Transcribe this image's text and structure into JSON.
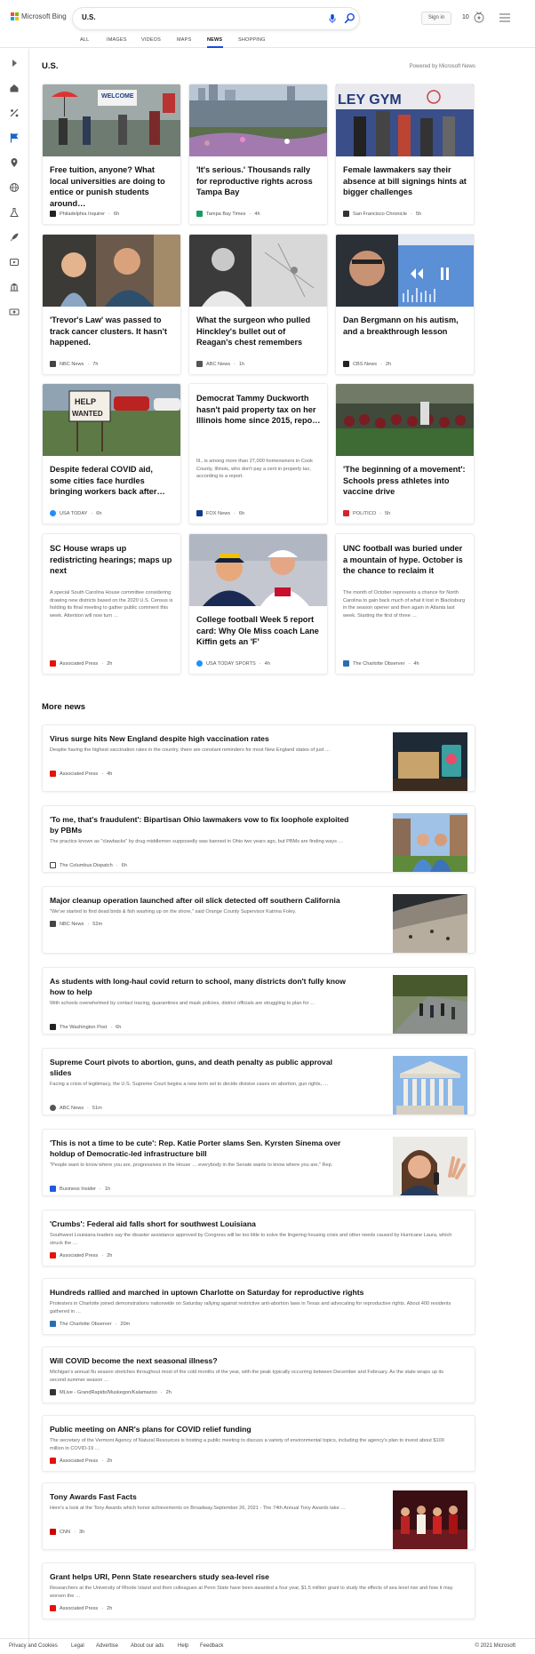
{
  "header": {
    "brand": "Microsoft Bing",
    "query": "U.S.",
    "sign_in": "Sign in",
    "points": "10",
    "colors": {
      "ms_red": "#f25022",
      "ms_green": "#7fba00",
      "ms_blue": "#00a4ef",
      "ms_yellow": "#ffb900",
      "accent": "#174ae4"
    }
  },
  "tabs": [
    "ALL",
    "IMAGES",
    "VIDEOS",
    "MAPS",
    "NEWS",
    "SHOPPING"
  ],
  "active_tab": "NEWS",
  "rail_icons": [
    "expand-icon",
    "home-icon",
    "sports-icon",
    "flag-icon",
    "location-icon",
    "globe-icon",
    "science-icon",
    "rocket-icon",
    "entertainment-icon",
    "bank-icon",
    "money-icon"
  ],
  "top": {
    "title": "U.S.",
    "powered": "Powered by Microsoft News"
  },
  "cards": [
    {
      "title": "Free tuition, anyone? What local universities are doing to entice or punish students around…",
      "source": "Philadelphia Inquirer",
      "time": "6h",
      "logo_color": "#222222"
    },
    {
      "title": "'It's serious.' Thousands rally for reproductive rights across Tampa Bay",
      "source": "Tampa Bay Times",
      "time": "4h",
      "logo_color": "#1a9a62"
    },
    {
      "title": "Female lawmakers say their absence at bill signings hints at bigger challenges",
      "source": "San Francisco Chronicle",
      "time": "5h",
      "logo_color": "#333333"
    },
    {
      "title": "'Trevor's Law' was passed to track cancer clusters. It hasn't happened.",
      "source": "NBC News",
      "time": "7h",
      "logo_color": "#444444"
    },
    {
      "title": "What the surgeon who pulled Hinckley's bullet out of Reagan's chest remembers",
      "source": "ABC News",
      "time": "1h",
      "logo_color": "#555555"
    },
    {
      "title": "Dan Bergmann on his autism, and a breakthrough lesson",
      "source": "CBS News",
      "time": "2h",
      "logo_color": "#222222"
    },
    {
      "title": "Despite federal COVID aid, some cities face hurdles bringing workers back after…",
      "source": "USA TODAY",
      "time": "6h",
      "logo_color": "#1e90ff"
    },
    {
      "title": "Democrat Tammy Duckworth hasn't paid property tax on her Illinois home since 2015, repo…",
      "desc": "Ill., is among more than 27,000 homeowners in Cook County, Illinois, who don't pay a cent in property tax, according to a report.",
      "source": "FOX News",
      "time": "6h",
      "logo_color": "#123a8c"
    },
    {
      "title": "'The beginning of a movement': Schools press athletes into vaccine drive",
      "source": "POLITICO",
      "time": "5h",
      "logo_color": "#d4242b"
    },
    {
      "title": "SC House wraps up redistricting hearings; maps up next",
      "desc": "A special South Carolina House committee considering drawing new districts based on the 2020 U.S. Census is holding its final meeting to gather public comment this week. Attention will now turn …",
      "source": "Associated Press",
      "time": "2h",
      "logo_color": "#e3120b"
    },
    {
      "title": "College football Week 5 report card: Why Ole Miss coach Lane Kiffin gets an 'F'",
      "source": "USA TODAY SPORTS",
      "time": "4h",
      "logo_color": "#1e90ff"
    },
    {
      "title": "UNC football was buried under a mountain of hype. October is the chance to reclaim it",
      "desc": "The month of October represents a chance for North Carolina to gain back much of what it lost in Blacksburg in the season opener and then again in Atlanta last week. Starting the first of three …",
      "source": "The Charlotte Observer",
      "time": "4h",
      "logo_color": "#2a6db5"
    }
  ],
  "more_news_title": "More news",
  "more": [
    {
      "title": "Virus surge hits New England despite high vaccination rates",
      "desc": "Despite having the highest vaccination rates in the country, there are constant reminders for most New England states of just …",
      "source": "Associated Press",
      "time": "4h",
      "logo_color": "#e3120b"
    },
    {
      "title": "'To me, that's fraudulent': Bipartisan Ohio lawmakers vow to fix loophole exploited by PBMs",
      "desc": "The practice known as \"clawbacks\" by drug middlemen supposedly was banned in Ohio two years ago, but PBMs are finding ways …",
      "source": "The Columbus Dispatch",
      "time": "6h",
      "logo_color": "#444444"
    },
    {
      "title": "Major cleanup operation launched after oil slick detected off southern California",
      "desc": "\"We've started to find dead birds & fish washing up on the shore,\" said Orange County Supervisor Katrina Foley.",
      "source": "NBC News",
      "time": "52m",
      "logo_color": "#444444"
    },
    {
      "title": "As students with long-haul covid return to school, many districts don't fully know how to help",
      "desc": "With schools overwhelmed by contact tracing, quarantines and mask policies, district officials are struggling to plan for …",
      "source": "The Washington Post",
      "time": "6h",
      "logo_color": "#222222"
    },
    {
      "title": "Supreme Court pivots to abortion, guns, and death penalty as public approval slides",
      "desc": "Facing a crisis of legitimacy, the U.S. Supreme Court begins a new term set to decide divisive cases on abortion, gun rights, …",
      "source": "ABC News",
      "time": "51m",
      "logo_color": "#555555"
    },
    {
      "title": "'This is not a time to be cute': Rep. Katie Porter slams Sen. Kyrsten Sinema over holdup of Democratic-led infrastructure bill",
      "desc": "\"People want to know where you are, progressives in the House … everybody in the Senate wants to know where you are,\" Rep.",
      "source": "Business Insider",
      "time": "1h",
      "logo_color": "#1e5cd8"
    },
    {
      "title": "'Crumbs': Federal aid falls short for southwest Louisiana",
      "desc": "Southwest Louisiana leaders say the disaster assistance approved by Congress will be too little to solve the lingering housing crisis and other needs caused by Hurricane Laura, which struck the …",
      "source": "Associated Press",
      "time": "2h",
      "logo_color": "#e3120b"
    },
    {
      "title": "Hundreds rallied and marched in uptown Charlotte on Saturday for reproductive rights",
      "desc": "Protesters in Charlotte joined demonstrations nationwide on Saturday rallying against restrictive anti-abortion laws in Texas and advocating for reproductive rights. About 400 residents gathered in …",
      "source": "The Charlotte Observer",
      "time": "20m",
      "logo_color": "#2a6db5"
    },
    {
      "title": "Will COVID become the next seasonal illness?",
      "desc": "Michigan's annual flu season stretches throughout most of the cold months of the year, with the peak typically occurring between December and February. As the state wraps up its second summer season …",
      "source": "MLive - GrandRapids/Muskegon/Kalamazoo",
      "time": "2h",
      "logo_color": "#333333"
    },
    {
      "title": "Public meeting on ANR's plans for COVID relief funding",
      "desc": "The secretary of the Vermont Agency of Natural Resources is hosting a public meeting to discuss a variety of environmental topics, including the agency's plan to invest about $100 million in COVID-19 …",
      "source": "Associated Press",
      "time": "2h",
      "logo_color": "#e3120b"
    },
    {
      "title": "Tony Awards Fast Facts",
      "desc": "Here's a look at the Tony Awards which honor achievements on Broadway.September 26, 2021 - The 74th Annual Tony Awards take …",
      "source": "CNN",
      "time": "3h",
      "logo_color": "#cc0000"
    },
    {
      "title": "Grant helps URI, Penn State researchers study sea-level rise",
      "desc": "Researchers at the University of Rhode Island and their colleagues at Penn State have been awarded a four year, $1.5 million grant to study the effects of sea level rise and how it may worsen the …",
      "source": "Associated Press",
      "time": "2h",
      "logo_color": "#e3120b"
    }
  ],
  "footer": {
    "links": [
      "Privacy and Cookies",
      "Legal",
      "Advertise",
      "About our ads",
      "Help",
      "Feedback"
    ],
    "copyright": "© 2021 Microsoft"
  }
}
